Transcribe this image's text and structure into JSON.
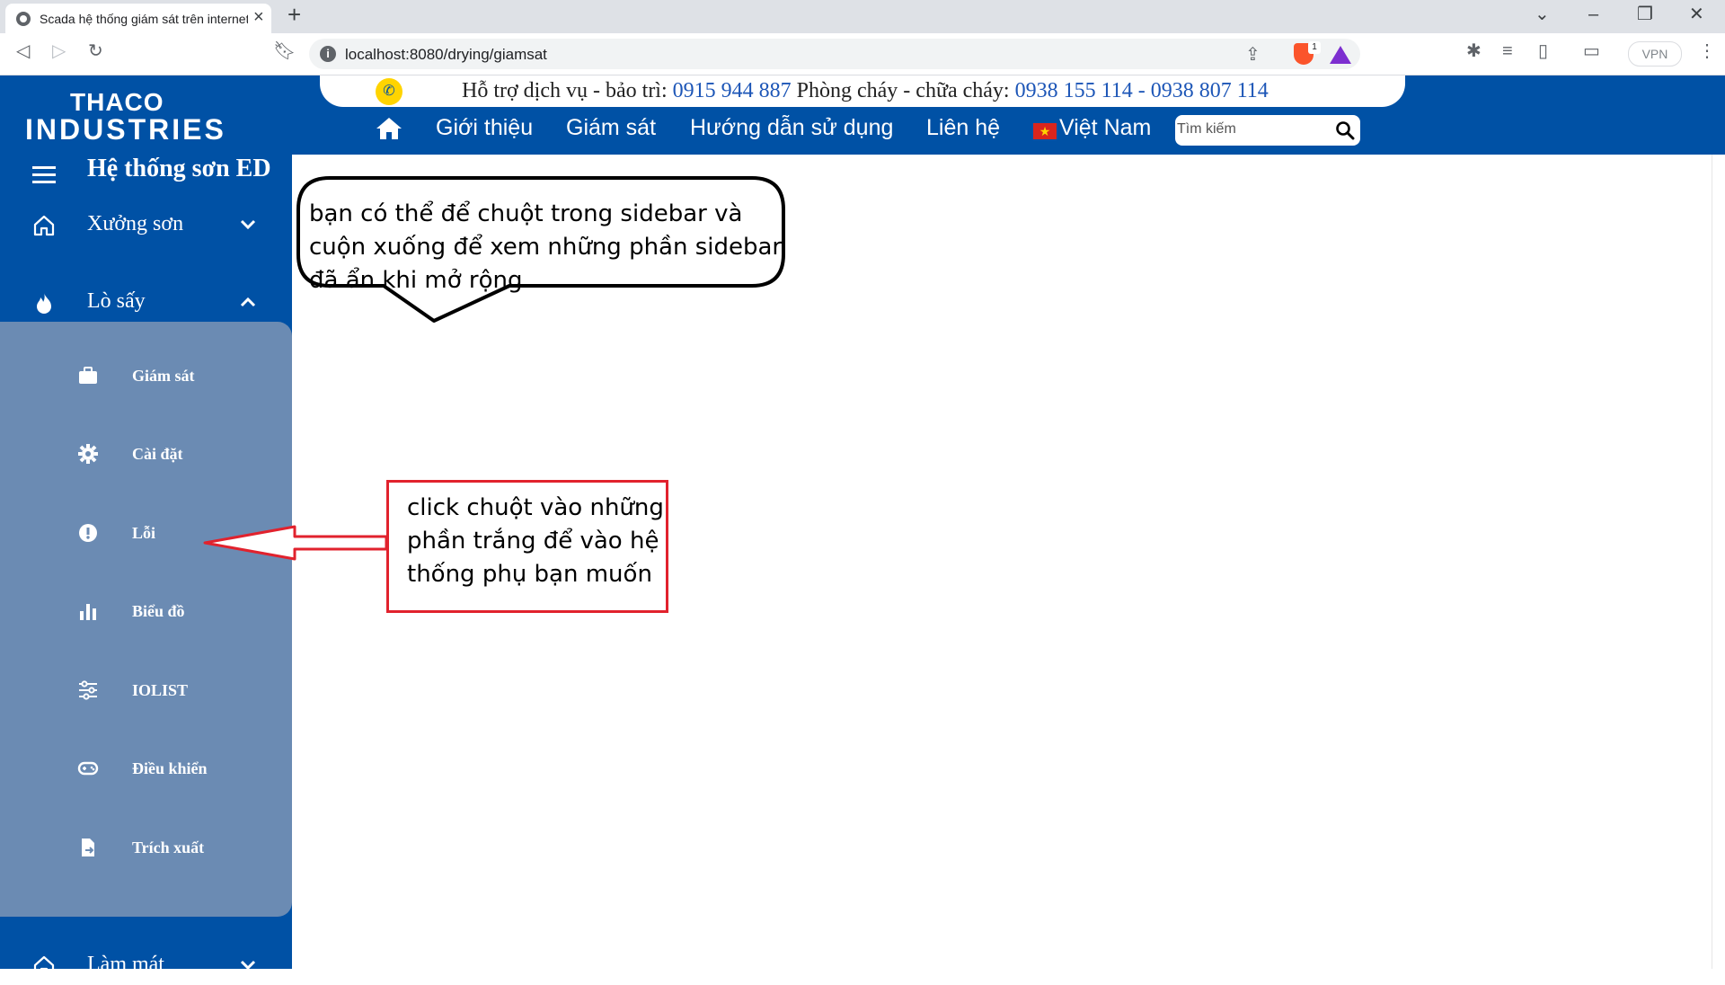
{
  "browser": {
    "tab_title": "Scada hệ thống giám sát trên internet",
    "url": "localhost:8080/drying/giamsat",
    "vpn_label": "VPN",
    "shield_badge": "1"
  },
  "site": {
    "logo_line1": "THACO",
    "logo_line2": "INDUSTRIES",
    "support": {
      "label1": "Hỗ trợ dịch vụ - bảo trì: ",
      "phone1": "0915 944 887",
      "label2": "  Phòng cháy - chữa cháy: ",
      "phone2": "0938 155 114 - 0938 807 114"
    },
    "nav": {
      "items": [
        "Giới thiệu",
        "Giám sát",
        "Hướng dẫn sử dụng",
        "Liên hệ"
      ],
      "language": "Việt Nam",
      "search_placeholder": "Tìm kiếm"
    },
    "colors": {
      "primary": "#0051a5",
      "submenu_bg": "#6b8bb3",
      "support_phone": "#1d56b7",
      "callout_border": "#e1222d"
    }
  },
  "sidebar": {
    "title": "Hệ thống sơn ED",
    "menu": [
      {
        "label": "Xưởng sơn",
        "icon": "home-icon",
        "expanded": false
      },
      {
        "label": "Lò sấy",
        "icon": "fire-icon",
        "expanded": true
      },
      {
        "label": "Làm mát",
        "icon": "home-icon",
        "expanded": false
      }
    ],
    "submenu": [
      {
        "label": "Giám sát",
        "icon": "briefcase-icon"
      },
      {
        "label": "Cài đặt",
        "icon": "gear-icon"
      },
      {
        "label": "Lỗi",
        "icon": "alert-icon"
      },
      {
        "label": "Biểu đồ",
        "icon": "chart-icon"
      },
      {
        "label": "IOLIST",
        "icon": "sliders-icon"
      },
      {
        "label": "Điều khiển",
        "icon": "gamepad-icon"
      },
      {
        "label": "Trích xuất",
        "icon": "file-export-icon"
      }
    ]
  },
  "annotations": {
    "speech_bubble": "bạn có thể để chuột trong sidebar và cuộn xuống để xem những phần sidebar đã ẩn khi mở rộng",
    "callout": "click chuột vào những phần trắng để vào hệ thống phụ bạn muốn"
  }
}
